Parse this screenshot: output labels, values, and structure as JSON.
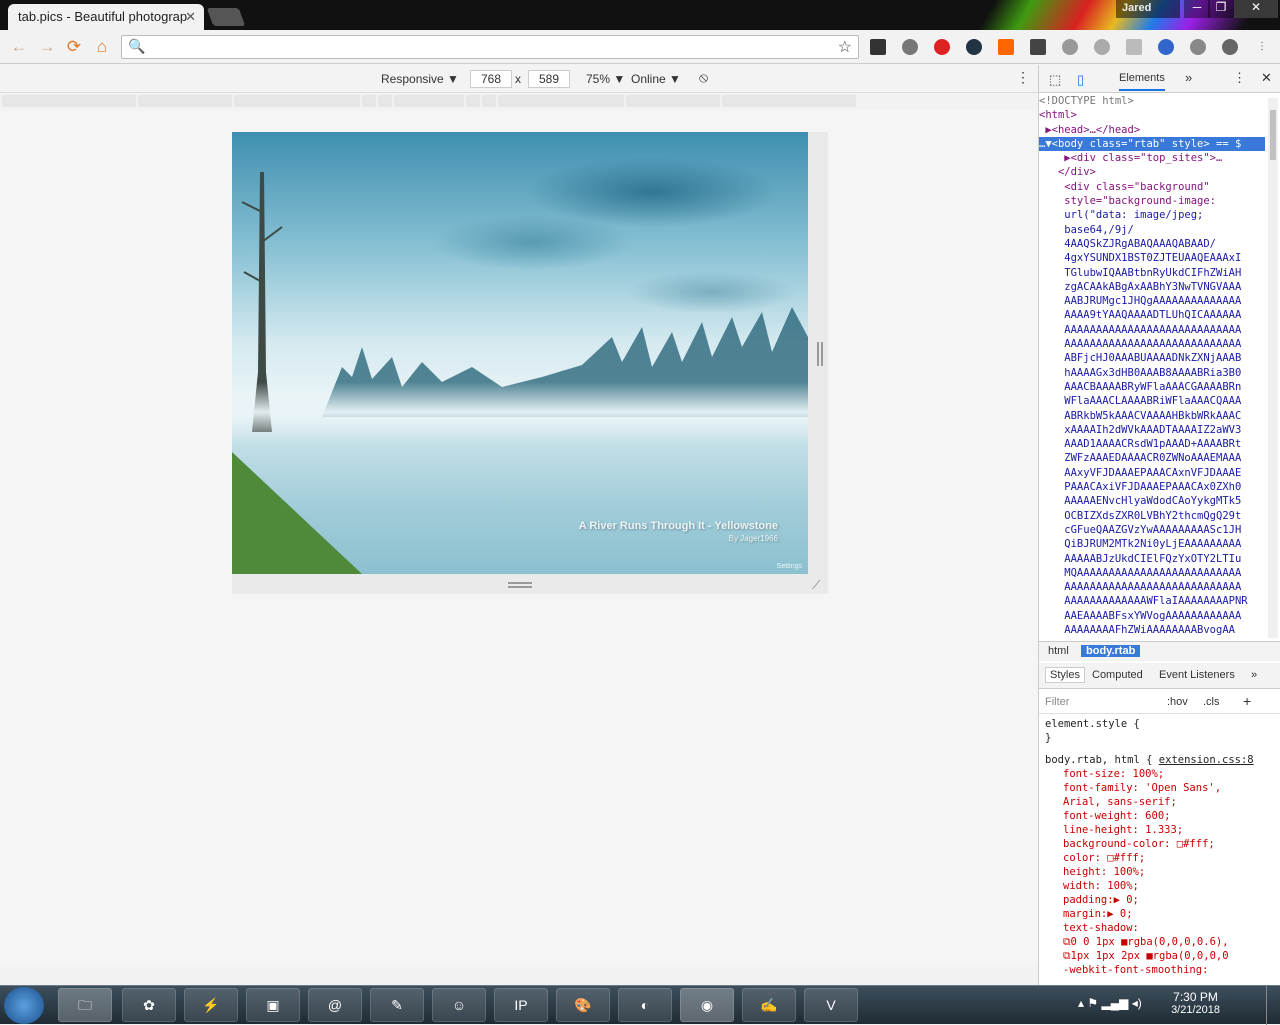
{
  "browser": {
    "tab_title": "tab.pics - Beautiful photograp",
    "tab_close": "✕",
    "user_name": "Jared",
    "window_buttons": [
      "─",
      "❐",
      "✕"
    ]
  },
  "toolbar": {
    "back": "←",
    "forward": "→",
    "reload": "⟳",
    "home": "⌂",
    "search_icon": "🔍",
    "url_value": "",
    "bookmark_star": "☆"
  },
  "device_toolbar": {
    "mode": "Responsive ▼",
    "width": "768",
    "times": "x",
    "height": "589",
    "zoom": "75% ▼",
    "network": "Online ▼",
    "rotate_icon": "⦸",
    "more": "⋮"
  },
  "page": {
    "caption_title": "A River Runs Through It - Yellowstone",
    "caption_author": "By Jager1966",
    "settings_label": "Settings"
  },
  "devtools": {
    "tab_elements": "Elements",
    "more_tabs": "»",
    "menu": "⋮",
    "close": "✕",
    "dom_lines": [
      {
        "text": "<!DOCTYPE html>",
        "cls": "cm"
      },
      {
        "text": "<html>",
        "cls": ""
      },
      {
        "text": " ▶<head>…</head>",
        "cls": ""
      },
      {
        "text": "…▼<body class=\"rtab\" style> == $",
        "cls": "sel"
      },
      {
        "text": "    ▶<div class=\"top_sites\">…",
        "cls": ""
      },
      {
        "text": "   </div>",
        "cls": ""
      },
      {
        "text": "    <div class=\"background\"",
        "cls": ""
      },
      {
        "text": "    style=\"background-image:",
        "cls": ""
      },
      {
        "text": "    url(\"data: image/jpeg;",
        "cls": "txt"
      },
      {
        "text": "    base64,/9j/",
        "cls": "txt"
      },
      {
        "text": "    4AAQSkZJRgABAQAAAQABAAD/",
        "cls": "txt"
      },
      {
        "text": "    4gxYSUNDX1BST0ZJTEUAAQEAAAxI",
        "cls": "txt"
      },
      {
        "text": "    TGlubwIQAABtbnRyUkdCIFhZWiAH",
        "cls": "txt"
      },
      {
        "text": "    zgACAAkABgAxAABhY3NwTVNGVAAA",
        "cls": "txt"
      },
      {
        "text": "    AABJRUMgc1JHQgAAAAAAAAAAAAAA",
        "cls": "txt"
      },
      {
        "text": "    AAAA9tYAAQAAAADTLUhQICAAAAAA",
        "cls": "txt"
      },
      {
        "text": "    AAAAAAAAAAAAAAAAAAAAAAAAAAAA",
        "cls": "txt"
      },
      {
        "text": "    AAAAAAAAAAAAAAAAAAAAAAAAAAAA",
        "cls": "txt"
      },
      {
        "text": "    ABFjcHJ0AAABUAAAADNkZXNjAAAB",
        "cls": "txt"
      },
      {
        "text": "    hAAAAGx3dHB0AAAB8AAAABRia3B0",
        "cls": "txt"
      },
      {
        "text": "    AAACBAAAABRyWFlaAAACGAAAABRn",
        "cls": "txt"
      },
      {
        "text": "    WFlaAAACLAAAABRiWFlaAAACQAAA",
        "cls": "txt"
      },
      {
        "text": "    ABRkbW5kAAACVAAAAHBkbWRkAAAC",
        "cls": "txt"
      },
      {
        "text": "    xAAAAIh2dWVkAAADTAAAAIZ2aWV3",
        "cls": "txt"
      },
      {
        "text": "    AAAD1AAAACRsdW1pAAAD+AAAABRt",
        "cls": "txt"
      },
      {
        "text": "    ZWFzAAAEDAAAACR0ZWNoAAAEMAAA",
        "cls": "txt"
      },
      {
        "text": "    AAxyVFJDAAAEPAAACAxnVFJDAAAE",
        "cls": "txt"
      },
      {
        "text": "    PAAACAxiVFJDAAAEPAAACAx0ZXh0",
        "cls": "txt"
      },
      {
        "text": "    AAAAAENvcHlyaWdodCAoYykgMTk5",
        "cls": "txt"
      },
      {
        "text": "    OCBIZXdsZXR0LVBhY2thcmQgQ29t",
        "cls": "txt"
      },
      {
        "text": "    cGFueQAAZGVzYwAAAAAAAAASc1JH",
        "cls": "txt"
      },
      {
        "text": "    QiBJRUM2MTk2Ni0yLjEAAAAAAAAA",
        "cls": "txt"
      },
      {
        "text": "    AAAAABJzUkdCIElFQzYxOTY2LTIu",
        "cls": "txt"
      },
      {
        "text": "    MQAAAAAAAAAAAAAAAAAAAAAAAAAA",
        "cls": "txt"
      },
      {
        "text": "    AAAAAAAAAAAAAAAAAAAAAAAAAAAA",
        "cls": "txt"
      },
      {
        "text": "    AAAAAAAAAAAAAWFlaIAAAAAAAAPNR",
        "cls": "txt"
      },
      {
        "text": "    AAEAAAABFsxYWVogAAAAAAAAAAAA",
        "cls": "txt"
      },
      {
        "text": "    AAAAAAAAFhZWiAAAAAAAABvogAA",
        "cls": "txt"
      }
    ],
    "crumb_html": "html",
    "crumb_body": "body.rtab",
    "styles_tabs": [
      "Styles",
      "Computed",
      "Event Listeners",
      "»"
    ],
    "filter_placeholder": "Filter",
    "filter_hov": ":hov",
    "filter_cls": ".cls",
    "filter_add": "+",
    "element_style_open": "element.style {",
    "element_style_close": "}",
    "rule_selector": "body.rtab, html {",
    "rule_source": "extension.css:8",
    "rule_props": [
      "font-size: 100%;",
      "font-family: 'Open Sans',",
      "  Arial, sans-serif;",
      "font-weight: 600;",
      "line-height: 1.333;",
      "background-color: □#fff;",
      "color: □#fff;",
      "height: 100%;",
      "width: 100%;",
      "padding:▶ 0;",
      "margin:▶ 0;",
      "text-shadow:",
      "  ⧉0 0 1px ■rgba(0,0,0,0.6),",
      "  ⧉1px 1px 2px ■rgba(0,0,0,0",
      "-webkit-font-smoothing:"
    ]
  },
  "taskbar": {
    "time": "7:30 PM",
    "date": "3/21/2018"
  }
}
